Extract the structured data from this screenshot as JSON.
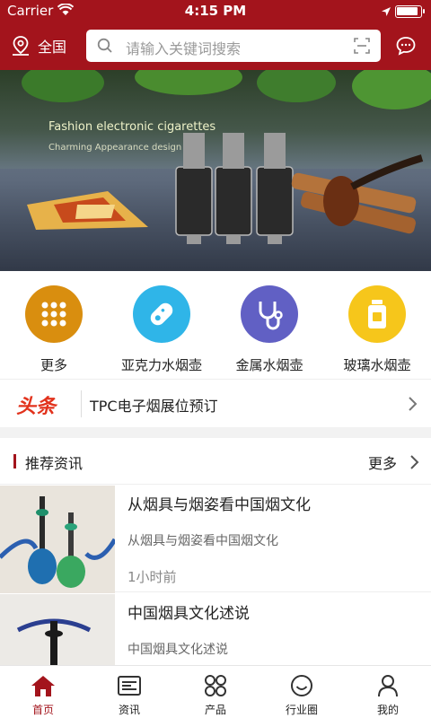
{
  "status_bar": {
    "carrier": "Carrier",
    "time": "4:15 PM"
  },
  "header": {
    "location": "全国",
    "search_placeholder": "请输入关键词搜索"
  },
  "banner": {
    "title": "Fashion electronic cigarettes",
    "subtitle": "Charming Appearance design"
  },
  "categories": [
    {
      "label": "更多",
      "icon": "grid-icon",
      "color": "#d98e0f"
    },
    {
      "label": "亚克力水烟壶",
      "icon": "capsule-icon",
      "color": "#2fb5e8"
    },
    {
      "label": "金属水烟壶",
      "icon": "stethoscope-icon",
      "color": "#6160c4"
    },
    {
      "label": "玻璃水烟壶",
      "icon": "jar-icon",
      "color": "#f6c61b"
    }
  ],
  "headline": {
    "tag": "头条",
    "text": "TPC电子烟展位预订"
  },
  "recommend": {
    "title": "推荐资讯",
    "more": "更多",
    "items": [
      {
        "title": "从烟具与烟姿看中国烟文化",
        "summary": "从烟具与烟姿看中国烟文化",
        "time": "1小时前"
      },
      {
        "title": "中国烟具文化述说",
        "summary": "中国烟具文化述说",
        "time": ""
      }
    ]
  },
  "tabs": [
    {
      "label": "首页",
      "icon": "home-icon",
      "active": true
    },
    {
      "label": "资讯",
      "icon": "news-icon",
      "active": false
    },
    {
      "label": "产品",
      "icon": "grid-four-icon",
      "active": false
    },
    {
      "label": "行业圈",
      "icon": "smile-icon",
      "active": false
    },
    {
      "label": "我的",
      "icon": "user-icon",
      "active": false
    }
  ],
  "colors": {
    "brand": "#a3141c",
    "headline_tag": "#e2321c"
  }
}
